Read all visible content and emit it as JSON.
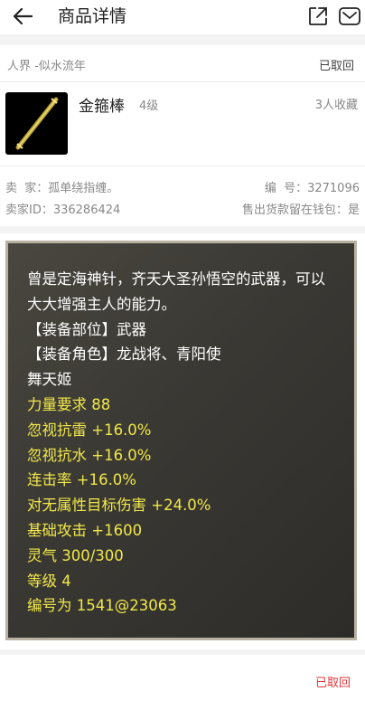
{
  "header": {
    "title": "商品详情",
    "back_icon": "arrow-left-icon",
    "share_icon": "share-icon",
    "mail_icon": "mail-icon"
  },
  "info": {
    "server": "人界 -似水流年",
    "status": "已取回",
    "item_name": "金箍棒",
    "item_level": "4级",
    "favorites": "3人收藏",
    "seller_label": "卖  家：孤单绕指缠。",
    "serial_label": "编  号：3271096",
    "seller_id_label": "卖家ID：336286424",
    "wallet_label": "售出货款留在钱包：是"
  },
  "description": {
    "lines": [
      {
        "text": "曾是定海神针，齐天大圣孙悟空的武器，可以大大增强主人的能力。",
        "color": "white"
      },
      {
        "text": "【装备部位】武器",
        "color": "white"
      },
      {
        "text": "【装备角色】龙战将、青阳使",
        "color": "white"
      },
      {
        "text": "舞天姬",
        "color": "white"
      },
      {
        "text": "力量要求 88",
        "color": "yellow"
      },
      {
        "text": "忽视抗雷 +16.0%",
        "color": "yellow"
      },
      {
        "text": "忽视抗水 +16.0%",
        "color": "yellow"
      },
      {
        "text": "连击率 +16.0%",
        "color": "yellow"
      },
      {
        "text": "对无属性目标伤害 +24.0%",
        "color": "yellow"
      },
      {
        "text": "基础攻击 +1600",
        "color": "yellow"
      },
      {
        "text": "灵气 300/300",
        "color": "yellow"
      },
      {
        "text": "等级 4",
        "color": "yellow"
      },
      {
        "text": "编号为 1541@23063",
        "color": "yellow"
      }
    ]
  },
  "footer": {
    "status": "已取回"
  },
  "colors": {
    "yellow_text": "#f0e84a",
    "status_red": "#e0373a",
    "panel_bg": "#3a3833"
  }
}
